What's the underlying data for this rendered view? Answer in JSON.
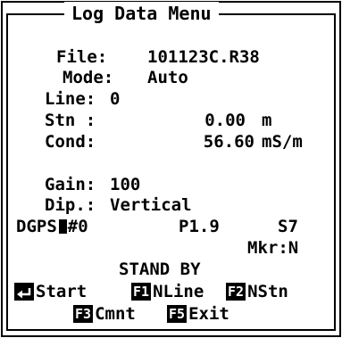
{
  "title": "Log Data Menu",
  "file": {
    "label": "File:",
    "value": "101123C.R38"
  },
  "mode": {
    "label": "Mode:",
    "value": "Auto"
  },
  "line": {
    "label": "Line:",
    "value": "0"
  },
  "stn": {
    "label": "Stn :",
    "value": "0.00",
    "unit": "m"
  },
  "cond": {
    "label": "Cond:",
    "value": "56.60",
    "unit": "mS/m"
  },
  "gain": {
    "label": "Gain:",
    "value": "100"
  },
  "dip": {
    "label": "Dip.:",
    "value": "Vertical"
  },
  "dgps": {
    "label": "DGPS",
    "value": "#0",
    "p": "P1.9",
    "s": "S7"
  },
  "marker": "Mkr:N",
  "status": "STAND BY",
  "keys": {
    "start": {
      "icon": "enter-key-icon",
      "label": "Start"
    },
    "f1": {
      "key": "F1",
      "label": "NLine"
    },
    "f2": {
      "key": "F2",
      "label": "NStn"
    },
    "f3": {
      "key": "F3",
      "label": "Cmnt"
    },
    "f5": {
      "key": "F5",
      "label": "Exit"
    }
  }
}
